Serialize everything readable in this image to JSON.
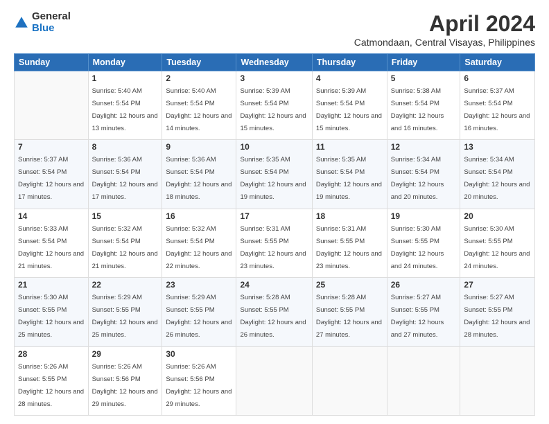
{
  "logo": {
    "general": "General",
    "blue": "Blue"
  },
  "title": "April 2024",
  "location": "Catmondaan, Central Visayas, Philippines",
  "days_header": [
    "Sunday",
    "Monday",
    "Tuesday",
    "Wednesday",
    "Thursday",
    "Friday",
    "Saturday"
  ],
  "weeks": [
    [
      {
        "num": "",
        "sunrise": "",
        "sunset": "",
        "daylight": ""
      },
      {
        "num": "1",
        "sunrise": "Sunrise: 5:40 AM",
        "sunset": "Sunset: 5:54 PM",
        "daylight": "Daylight: 12 hours and 13 minutes."
      },
      {
        "num": "2",
        "sunrise": "Sunrise: 5:40 AM",
        "sunset": "Sunset: 5:54 PM",
        "daylight": "Daylight: 12 hours and 14 minutes."
      },
      {
        "num": "3",
        "sunrise": "Sunrise: 5:39 AM",
        "sunset": "Sunset: 5:54 PM",
        "daylight": "Daylight: 12 hours and 15 minutes."
      },
      {
        "num": "4",
        "sunrise": "Sunrise: 5:39 AM",
        "sunset": "Sunset: 5:54 PM",
        "daylight": "Daylight: 12 hours and 15 minutes."
      },
      {
        "num": "5",
        "sunrise": "Sunrise: 5:38 AM",
        "sunset": "Sunset: 5:54 PM",
        "daylight": "Daylight: 12 hours and 16 minutes."
      },
      {
        "num": "6",
        "sunrise": "Sunrise: 5:37 AM",
        "sunset": "Sunset: 5:54 PM",
        "daylight": "Daylight: 12 hours and 16 minutes."
      }
    ],
    [
      {
        "num": "7",
        "sunrise": "Sunrise: 5:37 AM",
        "sunset": "Sunset: 5:54 PM",
        "daylight": "Daylight: 12 hours and 17 minutes."
      },
      {
        "num": "8",
        "sunrise": "Sunrise: 5:36 AM",
        "sunset": "Sunset: 5:54 PM",
        "daylight": "Daylight: 12 hours and 17 minutes."
      },
      {
        "num": "9",
        "sunrise": "Sunrise: 5:36 AM",
        "sunset": "Sunset: 5:54 PM",
        "daylight": "Daylight: 12 hours and 18 minutes."
      },
      {
        "num": "10",
        "sunrise": "Sunrise: 5:35 AM",
        "sunset": "Sunset: 5:54 PM",
        "daylight": "Daylight: 12 hours and 19 minutes."
      },
      {
        "num": "11",
        "sunrise": "Sunrise: 5:35 AM",
        "sunset": "Sunset: 5:54 PM",
        "daylight": "Daylight: 12 hours and 19 minutes."
      },
      {
        "num": "12",
        "sunrise": "Sunrise: 5:34 AM",
        "sunset": "Sunset: 5:54 PM",
        "daylight": "Daylight: 12 hours and 20 minutes."
      },
      {
        "num": "13",
        "sunrise": "Sunrise: 5:34 AM",
        "sunset": "Sunset: 5:54 PM",
        "daylight": "Daylight: 12 hours and 20 minutes."
      }
    ],
    [
      {
        "num": "14",
        "sunrise": "Sunrise: 5:33 AM",
        "sunset": "Sunset: 5:54 PM",
        "daylight": "Daylight: 12 hours and 21 minutes."
      },
      {
        "num": "15",
        "sunrise": "Sunrise: 5:32 AM",
        "sunset": "Sunset: 5:54 PM",
        "daylight": "Daylight: 12 hours and 21 minutes."
      },
      {
        "num": "16",
        "sunrise": "Sunrise: 5:32 AM",
        "sunset": "Sunset: 5:54 PM",
        "daylight": "Daylight: 12 hours and 22 minutes."
      },
      {
        "num": "17",
        "sunrise": "Sunrise: 5:31 AM",
        "sunset": "Sunset: 5:55 PM",
        "daylight": "Daylight: 12 hours and 23 minutes."
      },
      {
        "num": "18",
        "sunrise": "Sunrise: 5:31 AM",
        "sunset": "Sunset: 5:55 PM",
        "daylight": "Daylight: 12 hours and 23 minutes."
      },
      {
        "num": "19",
        "sunrise": "Sunrise: 5:30 AM",
        "sunset": "Sunset: 5:55 PM",
        "daylight": "Daylight: 12 hours and 24 minutes."
      },
      {
        "num": "20",
        "sunrise": "Sunrise: 5:30 AM",
        "sunset": "Sunset: 5:55 PM",
        "daylight": "Daylight: 12 hours and 24 minutes."
      }
    ],
    [
      {
        "num": "21",
        "sunrise": "Sunrise: 5:30 AM",
        "sunset": "Sunset: 5:55 PM",
        "daylight": "Daylight: 12 hours and 25 minutes."
      },
      {
        "num": "22",
        "sunrise": "Sunrise: 5:29 AM",
        "sunset": "Sunset: 5:55 PM",
        "daylight": "Daylight: 12 hours and 25 minutes."
      },
      {
        "num": "23",
        "sunrise": "Sunrise: 5:29 AM",
        "sunset": "Sunset: 5:55 PM",
        "daylight": "Daylight: 12 hours and 26 minutes."
      },
      {
        "num": "24",
        "sunrise": "Sunrise: 5:28 AM",
        "sunset": "Sunset: 5:55 PM",
        "daylight": "Daylight: 12 hours and 26 minutes."
      },
      {
        "num": "25",
        "sunrise": "Sunrise: 5:28 AM",
        "sunset": "Sunset: 5:55 PM",
        "daylight": "Daylight: 12 hours and 27 minutes."
      },
      {
        "num": "26",
        "sunrise": "Sunrise: 5:27 AM",
        "sunset": "Sunset: 5:55 PM",
        "daylight": "Daylight: 12 hours and 27 minutes."
      },
      {
        "num": "27",
        "sunrise": "Sunrise: 5:27 AM",
        "sunset": "Sunset: 5:55 PM",
        "daylight": "Daylight: 12 hours and 28 minutes."
      }
    ],
    [
      {
        "num": "28",
        "sunrise": "Sunrise: 5:26 AM",
        "sunset": "Sunset: 5:55 PM",
        "daylight": "Daylight: 12 hours and 28 minutes."
      },
      {
        "num": "29",
        "sunrise": "Sunrise: 5:26 AM",
        "sunset": "Sunset: 5:56 PM",
        "daylight": "Daylight: 12 hours and 29 minutes."
      },
      {
        "num": "30",
        "sunrise": "Sunrise: 5:26 AM",
        "sunset": "Sunset: 5:56 PM",
        "daylight": "Daylight: 12 hours and 29 minutes."
      },
      {
        "num": "",
        "sunrise": "",
        "sunset": "",
        "daylight": ""
      },
      {
        "num": "",
        "sunrise": "",
        "sunset": "",
        "daylight": ""
      },
      {
        "num": "",
        "sunrise": "",
        "sunset": "",
        "daylight": ""
      },
      {
        "num": "",
        "sunrise": "",
        "sunset": "",
        "daylight": ""
      }
    ]
  ]
}
